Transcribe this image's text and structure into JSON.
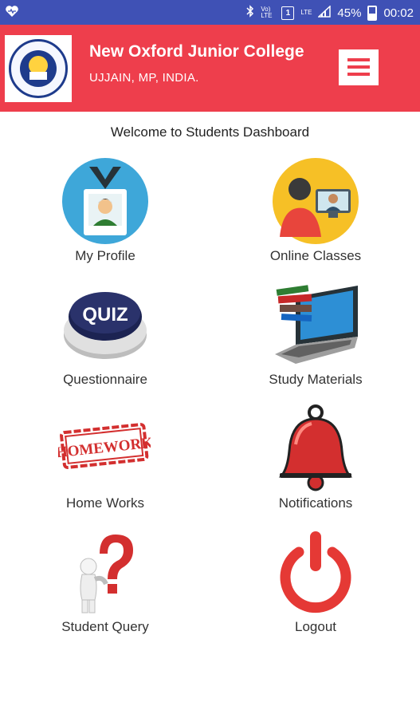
{
  "status_bar": {
    "battery": "45%",
    "time": "00:02",
    "signal_text": "Vo) LTE",
    "lte_text": "LTE"
  },
  "header": {
    "title": "New Oxford Junior College",
    "location": "UJJAIN, MP, INDIA.",
    "logo_text": "NEW OXFORD JUNIOR COLLEGE UJJAIN"
  },
  "welcome": "Welcome to Students Dashboard",
  "tiles": [
    {
      "label": "My Profile",
      "icon": "id-badge-icon"
    },
    {
      "label": "Online Classes",
      "icon": "video-call-icon"
    },
    {
      "label": "Questionnaire",
      "icon": "quiz-button-icon"
    },
    {
      "label": "Study Materials",
      "icon": "laptop-books-icon"
    },
    {
      "label": "Home Works",
      "icon": "homework-stamp-icon"
    },
    {
      "label": "Notifications",
      "icon": "bell-icon"
    },
    {
      "label": "Student Query",
      "icon": "question-mark-figure-icon"
    },
    {
      "label": "Logout",
      "icon": "power-icon"
    }
  ],
  "colors": {
    "status_bar": "#3f51b5",
    "header": "#ee3e4c",
    "menu_bars": "#ee3e4c"
  }
}
